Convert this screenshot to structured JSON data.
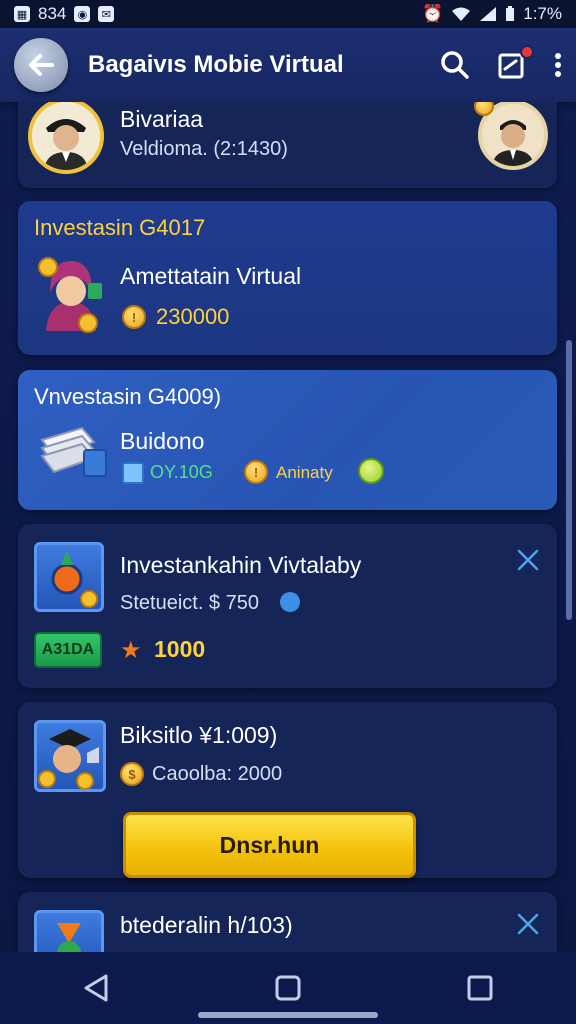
{
  "status_bar": {
    "time": "834",
    "battery": "1:7%"
  },
  "app_bar": {
    "title": "Bagaivıs Mobie Virtual"
  },
  "cards": [
    {
      "title": "Bivariaa",
      "subtitle": "Veldioma. (2:1430)"
    },
    {
      "header": "Investasin G4017",
      "title": "Amettatain Virtual",
      "amount": "230000"
    },
    {
      "header": "Vnvestasin G4009)",
      "title": "Buidono",
      "value": "OY.10G",
      "label": "Aninaty"
    },
    {
      "title": "Investankahin Vivtalaby",
      "subtitle": "Stetueict. $ 750",
      "badge": "A31DA",
      "amount": "1000"
    },
    {
      "title": "Biksitlo ¥1:009)",
      "subtitle": "Caoolba: 2000",
      "button": "Dnsr.hun"
    },
    {
      "title": "btederalin h/103)"
    }
  ],
  "colors": {
    "accent": "#ffd23c",
    "card": "#152558",
    "card_highlight": "#2f5fc2",
    "button": "#f2c10b"
  },
  "icons": [
    "back-arrow-icon",
    "search-icon",
    "inbox-icon",
    "more-vert-icon",
    "close-icon",
    "back-nav-icon",
    "home-nav-icon",
    "recents-nav-icon"
  ]
}
